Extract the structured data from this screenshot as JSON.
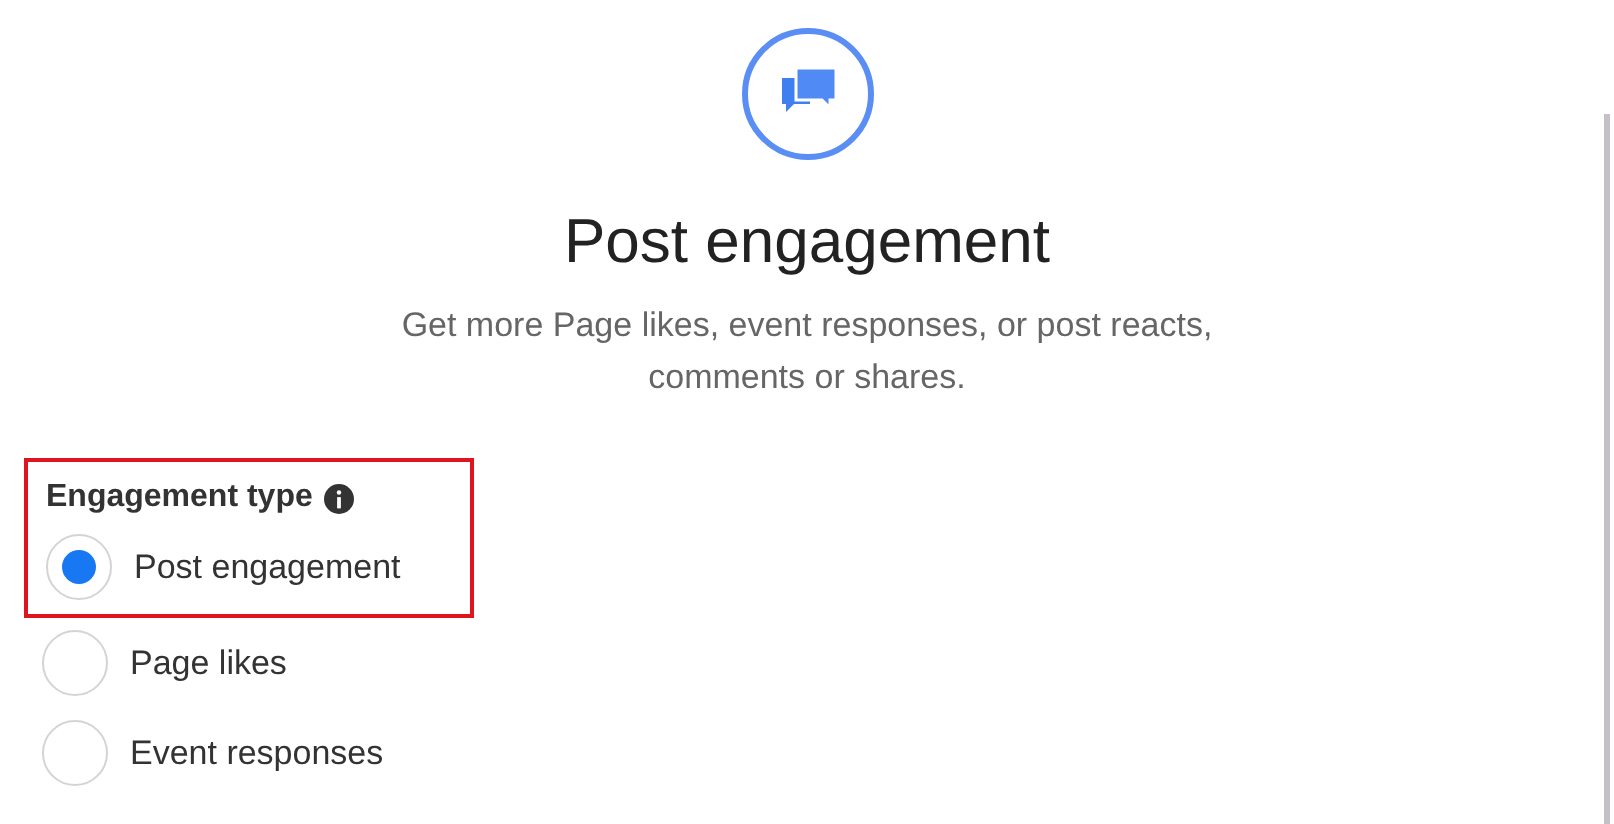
{
  "header": {
    "title": "Post engagement",
    "description": "Get more Page likes, event responses, or post reacts, comments or shares."
  },
  "engagement_type": {
    "label": "Engagement type",
    "highlighted": true,
    "options": [
      {
        "label": "Post engagement",
        "selected": true
      },
      {
        "label": "Page likes",
        "selected": false
      },
      {
        "label": "Event responses",
        "selected": false
      }
    ]
  }
}
